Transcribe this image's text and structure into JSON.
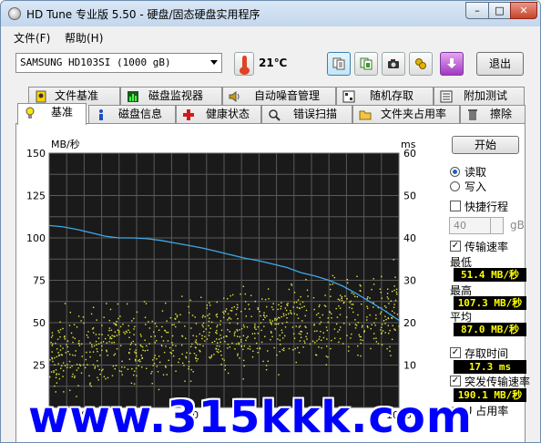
{
  "window": {
    "title": "HD Tune 专业版 5.50 - 硬盘/固态硬盘实用程序",
    "buttons": {
      "min": "–",
      "max": "□",
      "close": "✕"
    }
  },
  "menu": [
    {
      "label": "文件(F)"
    },
    {
      "label": "帮助(H)"
    }
  ],
  "toolbar": {
    "drive": "SAMSUNG HD103SI (1000 gB)",
    "temperature": "21℃",
    "icons": [
      "copy-info-icon",
      "copy-screenshot-icon",
      "camera-icon",
      "options-icon",
      "save-download-icon"
    ],
    "exit_label": "退出"
  },
  "tabs_top": [
    {
      "label": "文件基准",
      "icon": "file-benchmark-icon"
    },
    {
      "label": "磁盘监视器",
      "icon": "disk-monitor-icon"
    },
    {
      "label": "自动噪音管理",
      "icon": "speaker-icon"
    },
    {
      "label": "随机存取",
      "icon": "random-access-icon"
    },
    {
      "label": "附加测试",
      "icon": "extra-tests-icon"
    }
  ],
  "tabs_bottom": [
    {
      "label": "基准",
      "icon": "benchmark-bulb-icon",
      "active": true
    },
    {
      "label": "磁盘信息",
      "icon": "info-icon"
    },
    {
      "label": "健康状态",
      "icon": "health-cross-icon"
    },
    {
      "label": "错误扫描",
      "icon": "error-scan-icon"
    },
    {
      "label": "文件夹占用率",
      "icon": "folder-icon"
    },
    {
      "label": "擦除",
      "icon": "trash-icon"
    }
  ],
  "side": {
    "start_label": "开始",
    "read_label": "读取",
    "write_label": "写入",
    "mode": "read",
    "short_stroke_label": "快捷行程",
    "short_stroke_checked": false,
    "short_stroke_value": "40",
    "short_stroke_unit": "gB",
    "transfer_rate_label": "传输速率",
    "transfer_rate_checked": true,
    "min_label": "最低",
    "min_value": "51.4 MB/秒",
    "max_label": "最高",
    "max_value": "107.3 MB/秒",
    "avg_label": "平均",
    "avg_value": "87.0 MB/秒",
    "access_time_label": "存取时间",
    "access_time_checked": true,
    "access_time_value": "17.3 ms",
    "burst_label": "突发传输速率",
    "burst_checked": true,
    "burst_value": "190.1 MB/秒",
    "cpu_label": "CPU 占用率"
  },
  "chart_data": {
    "type": "line",
    "ylabel_left": "MB/秒",
    "ylabel_right": "ms",
    "y_left_range": [
      0,
      150
    ],
    "y_left_ticks": [
      "150",
      "125",
      "100",
      "75",
      "50",
      "25"
    ],
    "y_right_range": [
      0,
      60
    ],
    "y_right_ticks": [
      "60",
      "50",
      "40",
      "30",
      "20",
      "10"
    ],
    "x_range": [
      0,
      1000
    ],
    "x_ticks": [
      "100",
      "400",
      "1000"
    ],
    "grid": true,
    "colors": {
      "background": "#1a1a1a",
      "grid": "#5a5a5a",
      "transfer": "#3fa8e8",
      "access": "#e8e840"
    },
    "series": [
      {
        "name": "传输速率",
        "x": [
          0,
          40,
          80,
          120,
          160,
          200,
          240,
          280,
          320,
          360,
          400,
          440,
          480,
          520,
          560,
          600,
          640,
          680,
          720,
          760,
          800,
          840,
          880,
          920,
          960,
          1000
        ],
        "values": [
          107.3,
          106.5,
          105.0,
          103.0,
          101.0,
          100.0,
          100.0,
          99.5,
          98.5,
          97.0,
          95.5,
          94.0,
          92.0,
          90.0,
          88.0,
          86.5,
          84.5,
          82.5,
          79.5,
          77.5,
          75.0,
          71.5,
          67.0,
          62.0,
          57.0,
          51.4
        ]
      }
    ],
    "access_time_scatter": {
      "name": "存取时间",
      "avg_ms": 17.3
    }
  },
  "watermark": "www.315kkk.com"
}
